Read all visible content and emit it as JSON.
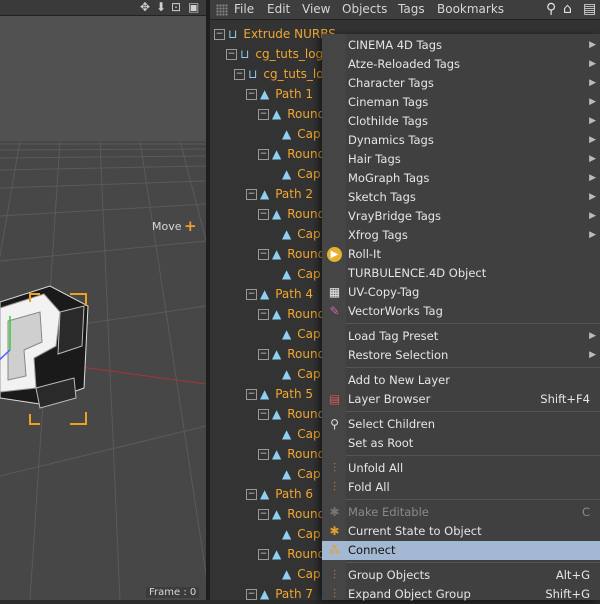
{
  "viewport": {
    "toolbar_icons": [
      "move-arrows-icon",
      "down-arrow-icon",
      "fullscreen-icon",
      "layout-icon"
    ],
    "move_label": "Move",
    "frame_label": "Frame : 0"
  },
  "menubar": {
    "items": [
      "File",
      "Edit",
      "View",
      "Objects",
      "Tags",
      "Bookmarks"
    ],
    "icons": [
      "search-icon",
      "home-icon",
      "layers-icon"
    ]
  },
  "tree": {
    "rows": [
      {
        "label": "Extrude NURBS"
      },
      {
        "label": "cg_tuts_logo"
      },
      {
        "label": "cg_tuts_lo"
      },
      {
        "label": "Path 1"
      },
      {
        "label": "Round"
      },
      {
        "label": "Cap"
      },
      {
        "label": "Round"
      },
      {
        "label": "Cap"
      },
      {
        "label": "Path 2"
      },
      {
        "label": "Round"
      },
      {
        "label": "Cap"
      },
      {
        "label": "Round"
      },
      {
        "label": "Cap"
      },
      {
        "label": "Path 4"
      },
      {
        "label": "Round"
      },
      {
        "label": "Cap"
      },
      {
        "label": "Round"
      },
      {
        "label": "Cap"
      },
      {
        "label": "Path 5"
      },
      {
        "label": "Round"
      },
      {
        "label": "Cap"
      },
      {
        "label": "Round"
      },
      {
        "label": "Cap"
      },
      {
        "label": "Path 6"
      },
      {
        "label": "Round"
      },
      {
        "label": "Cap"
      },
      {
        "label": "Round"
      },
      {
        "label": "Cap"
      },
      {
        "label": "Path 7"
      }
    ]
  },
  "context_menu": {
    "items": [
      {
        "label": "CINEMA 4D Tags",
        "submenu": true
      },
      {
        "label": "Atze-Reloaded Tags",
        "submenu": true
      },
      {
        "label": "Character Tags",
        "submenu": true
      },
      {
        "label": "Cineman Tags",
        "submenu": true
      },
      {
        "label": "Clothilde Tags",
        "submenu": true
      },
      {
        "label": "Dynamics Tags",
        "submenu": true
      },
      {
        "label": "Hair Tags",
        "submenu": true
      },
      {
        "label": "MoGraph Tags",
        "submenu": true
      },
      {
        "label": "Sketch Tags",
        "submenu": true
      },
      {
        "label": "VrayBridge Tags",
        "submenu": true
      },
      {
        "label": "Xfrog Tags",
        "submenu": true
      },
      {
        "label": "Roll-It",
        "icon": "roll-it-icon"
      },
      {
        "label": "TURBULENCE.4D Object"
      },
      {
        "label": "UV-Copy-Tag",
        "icon": "checker-icon"
      },
      {
        "label": "VectorWorks Tag",
        "icon": "vectorworks-icon"
      },
      {
        "label": "Load Tag Preset",
        "submenu": true
      },
      {
        "label": "Restore Selection",
        "submenu": true
      },
      {
        "label": "Add to New Layer"
      },
      {
        "label": "Layer Browser",
        "shortcut": "Shift+F4",
        "icon": "layer-browser-icon"
      },
      {
        "label": "Select Children",
        "icon": "select-children-icon"
      },
      {
        "label": "Set as Root"
      },
      {
        "label": "Unfold All",
        "icon": "unfold-icon"
      },
      {
        "label": "Fold All",
        "icon": "fold-icon"
      },
      {
        "label": "Make Editable",
        "shortcut": "C",
        "disabled": true,
        "icon": "make-editable-icon"
      },
      {
        "label": "Current State to Object",
        "icon": "current-state-icon"
      },
      {
        "label": "Connect",
        "highlighted": true,
        "icon": "connect-icon"
      },
      {
        "label": "Group Objects",
        "shortcut": "Alt+G",
        "icon": "group-icon"
      },
      {
        "label": "Expand Object Group",
        "shortcut": "Shift+G",
        "icon": "expand-group-icon"
      }
    ]
  },
  "colors": {
    "object_name": "#f0a830",
    "highlight": "#a3b8d2",
    "menu_bg": "#404040"
  }
}
